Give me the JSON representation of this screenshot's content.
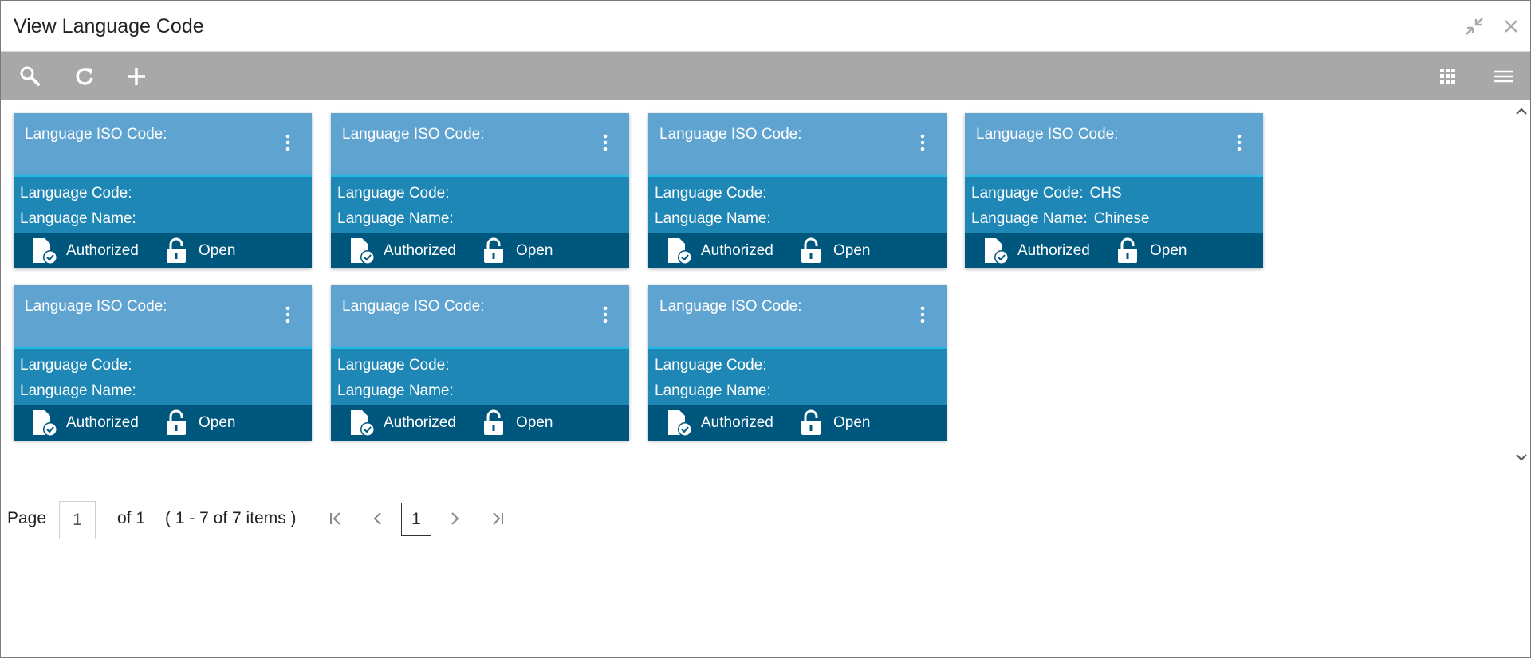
{
  "window": {
    "title": "View Language Code"
  },
  "cards": [
    {
      "iso_label": "Language ISO Code:",
      "code_label": "Language Code:",
      "code_value": "",
      "name_label": "Language Name:",
      "name_value": "",
      "auth_label": "Authorized",
      "open_label": "Open"
    },
    {
      "iso_label": "Language ISO Code:",
      "code_label": "Language Code:",
      "code_value": "",
      "name_label": "Language Name:",
      "name_value": "",
      "auth_label": "Authorized",
      "open_label": "Open"
    },
    {
      "iso_label": "Language ISO Code:",
      "code_label": "Language Code:",
      "code_value": "",
      "name_label": "Language Name:",
      "name_value": "",
      "auth_label": "Authorized",
      "open_label": "Open"
    },
    {
      "iso_label": "Language ISO Code:",
      "code_label": "Language Code:",
      "code_value": "CHS",
      "name_label": "Language Name:",
      "name_value": "Chinese",
      "auth_label": "Authorized",
      "open_label": "Open"
    },
    {
      "iso_label": "Language ISO Code:",
      "code_label": "Language Code:",
      "code_value": "",
      "name_label": "Language Name:",
      "name_value": "",
      "auth_label": "Authorized",
      "open_label": "Open"
    },
    {
      "iso_label": "Language ISO Code:",
      "code_label": "Language Code:",
      "code_value": "",
      "name_label": "Language Name:",
      "name_value": "",
      "auth_label": "Authorized",
      "open_label": "Open"
    },
    {
      "iso_label": "Language ISO Code:",
      "code_label": "Language Code:",
      "code_value": "",
      "name_label": "Language Name:",
      "name_value": "",
      "auth_label": "Authorized",
      "open_label": "Open"
    }
  ],
  "pagination": {
    "page_label": "Page",
    "page_value": "1",
    "of_label": "of 1",
    "items_label": "( 1 - 7 of 7 items )",
    "current_page": "1"
  },
  "colors": {
    "toolbar": "#a8a8a8",
    "card_head": "#5fa3d1",
    "card_body": "#1f87b5",
    "card_foot": "#00577e",
    "accent_line": "#1fb9e8"
  },
  "icons": [
    "minimize-icon",
    "close-icon",
    "search-icon",
    "refresh-icon",
    "add-icon",
    "grid-view-icon",
    "list-view-icon",
    "kebab-menu-icon",
    "authorized-doc-icon",
    "unlocked-icon",
    "first-page-icon",
    "prev-page-icon",
    "next-page-icon",
    "last-page-icon",
    "scroll-up-icon",
    "scroll-down-icon"
  ]
}
